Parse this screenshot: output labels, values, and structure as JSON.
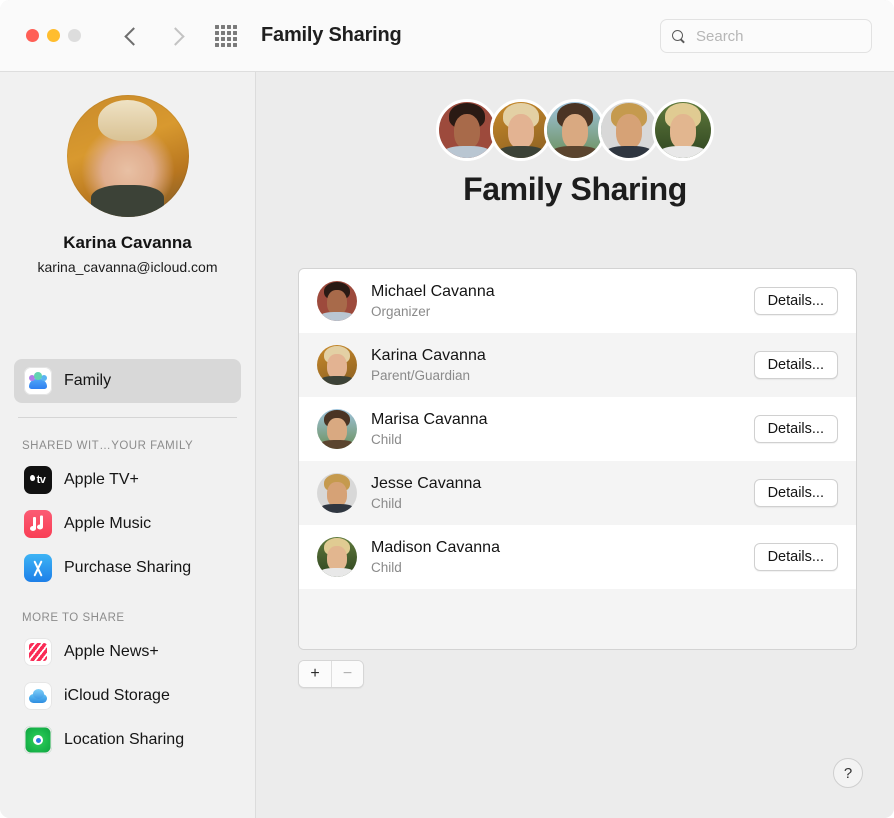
{
  "window": {
    "title": "Family Sharing",
    "traffic_lights": [
      "close",
      "minimize",
      "zoom"
    ]
  },
  "toolbar": {
    "back_icon": "chevron-left-icon",
    "forward_icon": "chevron-right-icon",
    "grid_icon": "grid-view-icon",
    "search_placeholder": "Search",
    "search_value": ""
  },
  "sidebar": {
    "profile": {
      "name": "Karina Cavanna",
      "email": "karina_cavanna@icloud.com"
    },
    "primary_item": {
      "label": "Family",
      "icon": "family-icon",
      "selected": true
    },
    "groups": [
      {
        "title": "SHARED WIT…YOUR FAMILY",
        "items": [
          {
            "label": "Apple TV+",
            "icon": "apple-tv-icon"
          },
          {
            "label": "Apple Music",
            "icon": "apple-music-icon"
          },
          {
            "label": "Purchase Sharing",
            "icon": "app-store-icon"
          }
        ]
      },
      {
        "title": "MORE TO SHARE",
        "items": [
          {
            "label": "Apple News+",
            "icon": "apple-news-icon"
          },
          {
            "label": "iCloud Storage",
            "icon": "icloud-icon"
          },
          {
            "label": "Location Sharing",
            "icon": "find-my-icon"
          }
        ]
      }
    ]
  },
  "main": {
    "title": "Family Sharing",
    "members": [
      {
        "name": "Michael Cavanna",
        "role": "Organizer",
        "button": "Details..."
      },
      {
        "name": "Karina Cavanna",
        "role": "Parent/Guardian",
        "button": "Details..."
      },
      {
        "name": "Marisa Cavanna",
        "role": "Child",
        "button": "Details..."
      },
      {
        "name": "Jesse Cavanna",
        "role": "Child",
        "button": "Details..."
      },
      {
        "name": "Madison Cavanna",
        "role": "Child",
        "button": "Details..."
      }
    ],
    "add_button": "+",
    "remove_button": "−",
    "help_button": "?"
  },
  "colors": {
    "sidebar_bg": "#f1f1f1",
    "content_bg": "#ececec",
    "selected_row": "#d8d8d8",
    "alt_row": "#f4f4f4",
    "text_primary": "#141414",
    "text_secondary": "#8a8a8a"
  }
}
